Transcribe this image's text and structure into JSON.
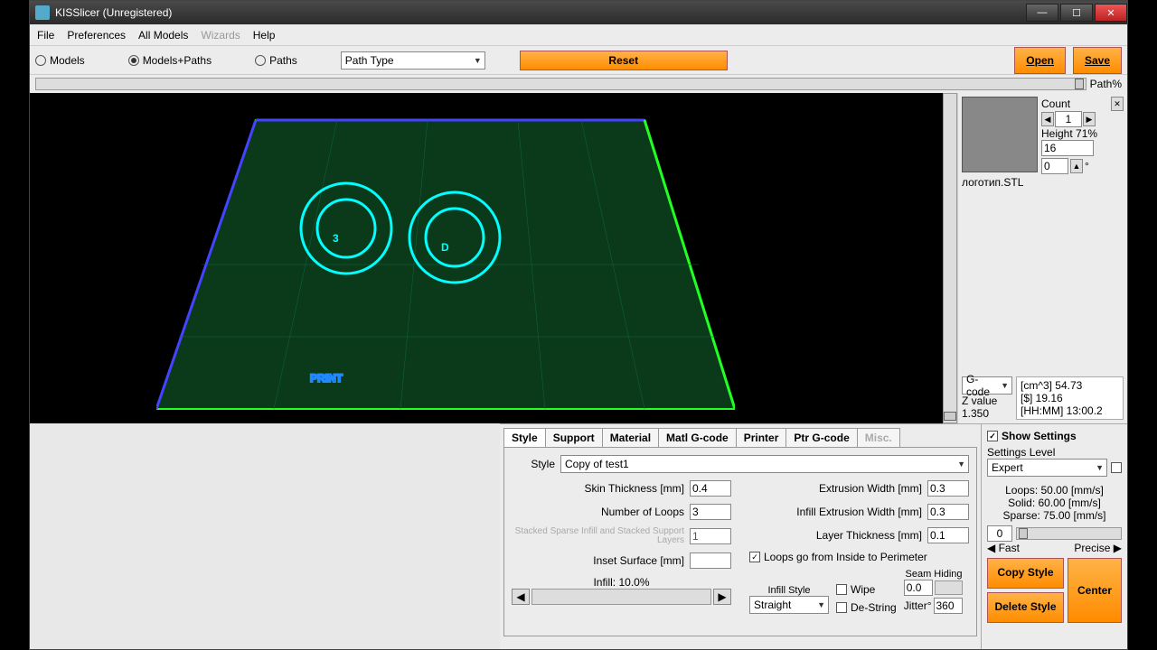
{
  "window": {
    "title": "KISSlicer (Unregistered)"
  },
  "menu": {
    "file": "File",
    "preferences": "Preferences",
    "allmodels": "All Models",
    "wizards": "Wizards",
    "help": "Help"
  },
  "toolbar": {
    "models": "Models",
    "modelspaths": "Models+Paths",
    "paths": "Paths",
    "pathtype": "Path Type",
    "reset": "Reset",
    "open": "Open",
    "save": "Save",
    "pathpct": "Path%"
  },
  "model": {
    "count_label": "Count",
    "count": "1",
    "height_label": "Height 71%",
    "height": "16",
    "angle": "0",
    "angle_unit": "°",
    "filename": "логотип.STL"
  },
  "stats": {
    "gcode": "G-code",
    "zlabel": "Z value",
    "zval": "1.350",
    "cm3": "[cm^3]  54.73",
    "dollar": "[$]  19.16",
    "time": "[HH:MM]  13:00.2"
  },
  "tabs": {
    "style": "Style",
    "support": "Support",
    "material": "Material",
    "matlg": "Matl G-code",
    "printer": "Printer",
    "ptrg": "Ptr G-code",
    "misc": "Misc."
  },
  "style_form": {
    "style_label": "Style",
    "style_value": "Copy of test1",
    "skin_label": "Skin Thickness [mm]",
    "skin": "0.4",
    "loops_label": "Number of Loops",
    "loops": "3",
    "stacked_label": "Stacked Sparse Infill and Stacked Support Layers",
    "stacked": "1",
    "inset_label": "Inset  Surface [mm]",
    "inset": "",
    "extw_label": "Extrusion Width [mm]",
    "extw": "0.3",
    "infw_label": "Infill Extrusion Width [mm]",
    "infw": "0.3",
    "layer_label": "Layer Thickness [mm]",
    "layer": "0.1",
    "loopsgo": "Loops go from Inside to Perimeter",
    "infill_label": "Infill: 10.0%",
    "infillstyle_label": "Infill Style",
    "infillstyle": "Straight",
    "wipe": "Wipe",
    "destring": "De-String",
    "seam_label": "Seam Hiding",
    "seam": "0.0",
    "jitter_label": "Jitter°",
    "jitter": "360"
  },
  "right": {
    "show": "Show Settings",
    "level_label": "Settings Level",
    "level": "Expert",
    "loops_stat": "Loops:  50.00 [mm/s]",
    "solid_stat": "Solid:  60.00 [mm/s]",
    "sparse_stat": "Sparse: 75.00 [mm/s]",
    "speedval": "0",
    "fast": "Fast",
    "precise": "Precise",
    "copy": "Copy Style",
    "delete": "Delete Style",
    "center": "Center"
  }
}
